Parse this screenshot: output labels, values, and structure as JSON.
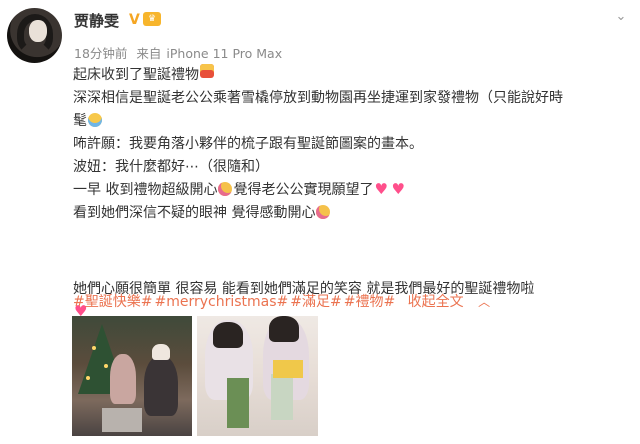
{
  "post": {
    "author": "贾静雯",
    "verified_mark": "V",
    "timestamp": "18分钟前",
    "source_prefix": "来自",
    "source_device": "iPhone 11 Pro Max",
    "lines": [
      "起床收到了聖誕禮物",
      "深深相信是聖誕老公公乘著雪橇停放到動物園再坐捷運到家發禮物（只能說好時",
      "髦",
      "咘許願：我要角落小夥伴的梳子跟有聖誕節圖案的畫本。",
      "波妞：我什麼都好⋯（很隨和）",
      "一早 收到禮物超級開心",
      "覺得老公公實現願望了",
      "看到她們深信不疑的眼神 覺得感動開心",
      "她們心願很簡單 很容易 能看到她們滿足的笑容 就是我們最好的聖誕禮物啦"
    ],
    "tags": [
      "#聖誕快樂#",
      "#merrychristmas#",
      "#滿足#",
      "#禮物#"
    ],
    "collapse_label": "收起全文",
    "collapse_arrow": "︿"
  },
  "icons": {
    "menu": "chevron-down-icon",
    "accent": "#eb7350",
    "tag_color": "#eb7350"
  }
}
